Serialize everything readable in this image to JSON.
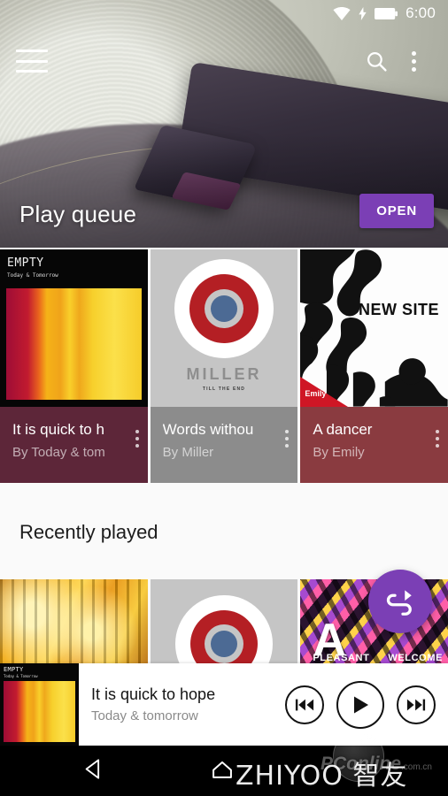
{
  "status_bar": {
    "time": "6:00",
    "icons": [
      "wifi-icon",
      "charging-bolt-icon",
      "battery-icon"
    ]
  },
  "app_bar": {
    "menu_icon": "hamburger-menu-icon",
    "search_icon": "search-icon",
    "overflow_icon": "kebab-menu-icon"
  },
  "hero": {
    "title": "Play queue",
    "button_label": "OPEN",
    "accent_color": "#7b3fb5"
  },
  "cards": [
    {
      "title": "It is quick to h",
      "subtitle": "By Today & tom",
      "art": {
        "label": "EMPTY",
        "sublabel": "Today & Tomorrow",
        "style": "empty-bars"
      },
      "footer_color": "#5d2639",
      "overflow_icon": "kebab-menu-icon"
    },
    {
      "title": "Words withou",
      "subtitle": "By Miller",
      "art": {
        "label": "MILLER",
        "sublabel": "TILL THE END",
        "style": "bullseye"
      },
      "footer_color": "#8c8c8c",
      "overflow_icon": "kebab-menu-icon"
    },
    {
      "title": "A dancer",
      "subtitle": "By Emily",
      "art": {
        "label": "NEW SITE",
        "tag": "Emily",
        "style": "blobs"
      },
      "footer_color": "#8a3b40",
      "overflow_icon": "kebab-menu-icon"
    }
  ],
  "recently_played": {
    "title": "Recently played",
    "items": [
      {
        "art_style": "fire-stripes",
        "label": ""
      },
      {
        "art_style": "bullseye",
        "label": ""
      },
      {
        "art_style": "pleasant",
        "label": "A",
        "label_left": "PLEASANT",
        "label_right": "WELCOME"
      }
    ],
    "fab_icon": "shuffle-icon"
  },
  "mini_player": {
    "title": "It is quick to hope",
    "artist": "Today & tomorrow",
    "art_label": "EMPTY",
    "art_sublabel": "Today & Tomorrow",
    "previous_icon": "skip-previous-icon",
    "play_icon": "play-icon",
    "next_icon": "skip-next-icon"
  },
  "nav_bar": {
    "back_icon": "back-triangle-icon",
    "home_icon": "home-icon"
  },
  "watermarks": {
    "zhiyoo": "ZHIYOO 智友",
    "pconline": "PConline",
    "pconline_suffix": ".com.cn"
  }
}
